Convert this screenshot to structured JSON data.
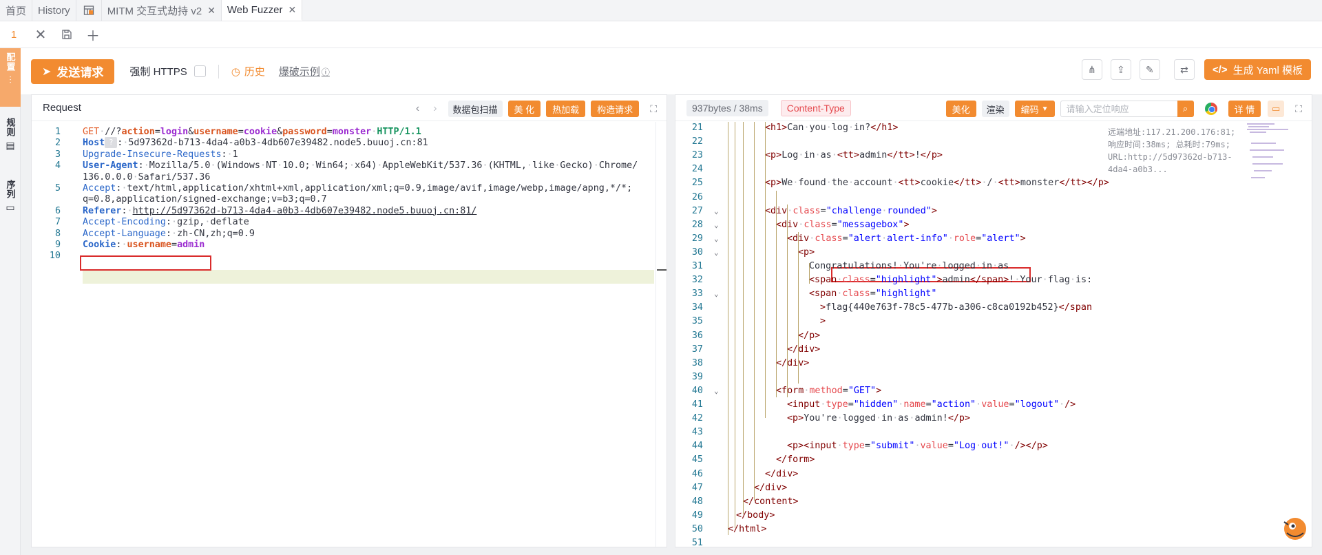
{
  "tabs": [
    {
      "label": "首页"
    },
    {
      "label": "History"
    },
    {
      "label": ""
    },
    {
      "label": "MITM 交互式劫持 v2"
    },
    {
      "label": "Web Fuzzer"
    }
  ],
  "subbar": {
    "tab_number": "1"
  },
  "sidebar": {
    "items": [
      {
        "label": "配置"
      },
      {
        "label": "规则"
      },
      {
        "label": "序列"
      }
    ]
  },
  "toolbar": {
    "send_label": "发送请求",
    "https_label": "强制 HTTPS",
    "https_checked": false,
    "history_label": "历史",
    "blast_label": "爆破示例",
    "yaml_label": "生成 Yaml 模板"
  },
  "request": {
    "title": "Request",
    "btn_scan": "数据包扫描",
    "btn_beautify": "美 化",
    "btn_hotload": "热加载",
    "btn_construct": "构造请求",
    "lines": [
      "GET /?action=login&username=cookie&password=monster HTTP/1.1",
      "Host: 5d97362d-b713-4da4-a0b3-4db607e39482.node5.buuoj.cn:81",
      "Upgrade-Insecure-Requests: 1",
      "User-Agent: Mozilla/5.0 (Windows NT 10.0; Win64; x64) AppleWebKit/537.36 (KHTML, like Gecko) Chrome/",
      "136.0.0.0 Safari/537.36",
      "Accept: text/html,application/xhtml+xml,application/xml;q=0.9,image/avif,image/webp,image/apng,*/*;",
      "q=0.8,application/signed-exchange;v=b3;q=0.7",
      "Referer: http://5d97362d-b713-4da4-a0b3-4db607e39482.node5.buuoj.cn:81/",
      "Accept-Encoding: gzip, deflate",
      "Accept-Language: zh-CN,zh;q=0.9",
      "Cookie: username=admin",
      ""
    ],
    "line_numbers": [
      "1",
      "2",
      "3",
      "4",
      "",
      "5",
      "",
      "6",
      "7",
      "8",
      "9",
      "10"
    ]
  },
  "response": {
    "size_time": "937bytes / 38ms",
    "content_type": "Content-Type",
    "btn_beautify": "美化",
    "btn_render": "渲染",
    "btn_encode": "编码",
    "search_placeholder": "请输入定位响应",
    "btn_detail": "详 情",
    "remote_info": "远端地址:117.21.200.176:81; 响应时间:38ms; 总耗时:79ms; URL:http://5d97362d-b713-4da4-a0b3...",
    "line_numbers": [
      "21",
      "22",
      "23",
      "24",
      "25",
      "26",
      "27",
      "28",
      "29",
      "30",
      "31",
      "32",
      "33",
      "34",
      "35",
      "36",
      "37",
      "38",
      "39",
      "40",
      "41",
      "42",
      "43",
      "44",
      "45",
      "46",
      "47",
      "48",
      "49",
      "50",
      "51"
    ],
    "flag": "flag{440e763f-78c5-477b-a306-c8ca0192b452}"
  },
  "colors": {
    "accent": "#f28b30",
    "highlight_box": "#d92b2b"
  }
}
